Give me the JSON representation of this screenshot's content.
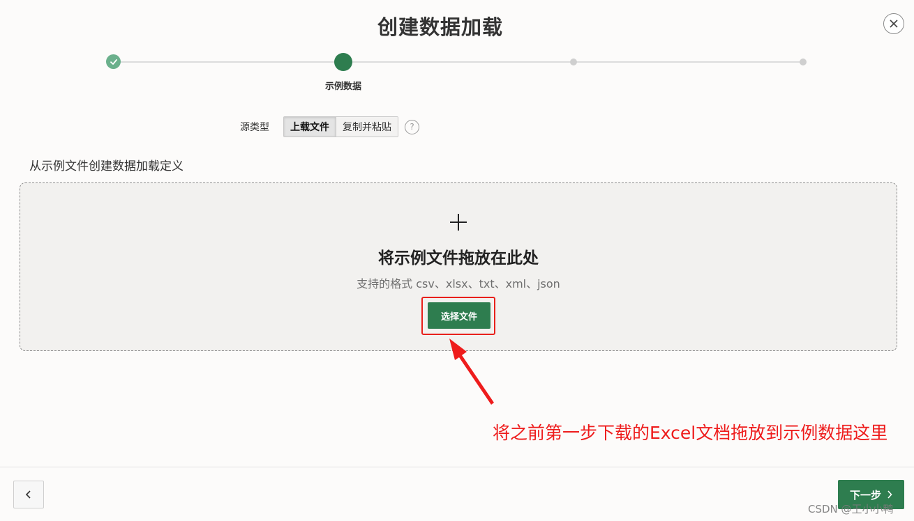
{
  "dialog": {
    "title": "创建数据加载"
  },
  "progress": {
    "steps": [
      {
        "state": "done",
        "label": ""
      },
      {
        "state": "current",
        "label": "示例数据"
      },
      {
        "state": "pending",
        "label": ""
      },
      {
        "state": "pending",
        "label": ""
      }
    ]
  },
  "source": {
    "label": "源类型",
    "options": [
      "上载文件",
      "复制并粘贴"
    ],
    "selected": "上载文件",
    "help": "?"
  },
  "section": {
    "heading": "从示例文件创建数据加载定义"
  },
  "dropzone": {
    "title": "将示例文件拖放在此处",
    "subtitle": "支持的格式 csv、xlsx、txt、xml、json",
    "button_label": "选择文件"
  },
  "annotation": {
    "text": "将之前第一步下载的Excel文档拖放到示例数据这里"
  },
  "footer": {
    "next_label": "下一步"
  },
  "watermark": "CSDN @王小小鸭",
  "colors": {
    "accent": "#2e7d4f",
    "done": "#6bb08c",
    "annotation": "#ee1c1c"
  }
}
